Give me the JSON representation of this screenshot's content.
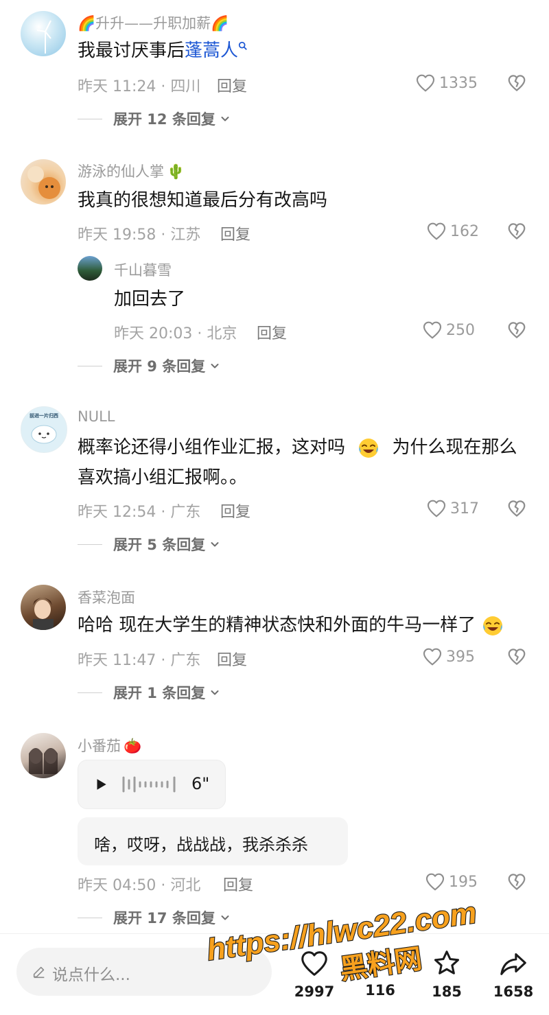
{
  "colors": {
    "link": "#1e58d4",
    "meta": "#a3a3a3",
    "background": "#ffffff",
    "watermark": "#f7a11e"
  },
  "comments": [
    {
      "username": "🌈升升——升职加薪🌈",
      "text_plain": "我最讨厌事后",
      "text_link": "蓬蒿人",
      "time": "昨天 11:24 · 四川",
      "reply_label": "回复",
      "likes": "1335",
      "expand": "展开 12 条回复"
    },
    {
      "username": "游泳的仙人掌",
      "username_emoji": "🌵",
      "text": "我真的很想知道最后分有改高吗",
      "time": "昨天 19:58 · 江苏",
      "reply_label": "回复",
      "likes": "162",
      "reply": {
        "username": "千山暮雪",
        "text": "加回去了",
        "time": "昨天 20:03 · 北京",
        "reply_label": "回复",
        "likes": "250"
      },
      "expand": "展开 9 条回复"
    },
    {
      "username": "NULL",
      "avatar_text": "前进一片归西",
      "text_a": "概率论还得小组作业汇报，这对吗",
      "text_b": "为什么现在那么喜欢搞小组汇报啊。。",
      "time": "昨天 12:54 · 广东",
      "reply_label": "回复",
      "likes": "317",
      "expand": "展开 5 条回复"
    },
    {
      "username": "香菜泡面",
      "text": "哈哈 现在大学生的精神状态快和外面的牛马一样了",
      "time": "昨天 11:47 · 广东",
      "reply_label": "回复",
      "likes": "395",
      "expand": "展开 1 条回复"
    },
    {
      "username": "小番茄",
      "username_emoji": "🍅",
      "voice_duration": "6\"",
      "voice_transcript": "啥，哎呀，战战战，我杀杀杀",
      "time": "昨天 04:50 · 河北",
      "reply_label": "回复",
      "likes": "195",
      "expand": "展开 17 条回复"
    }
  ],
  "bottom_bar": {
    "input_placeholder": "说点什么...",
    "likes_count": "2997",
    "comments_count": "116",
    "favorites_count": "185",
    "shares_count": "1658"
  },
  "watermark": {
    "line1": "https://hlwc22.com",
    "line2": "黑料网"
  }
}
